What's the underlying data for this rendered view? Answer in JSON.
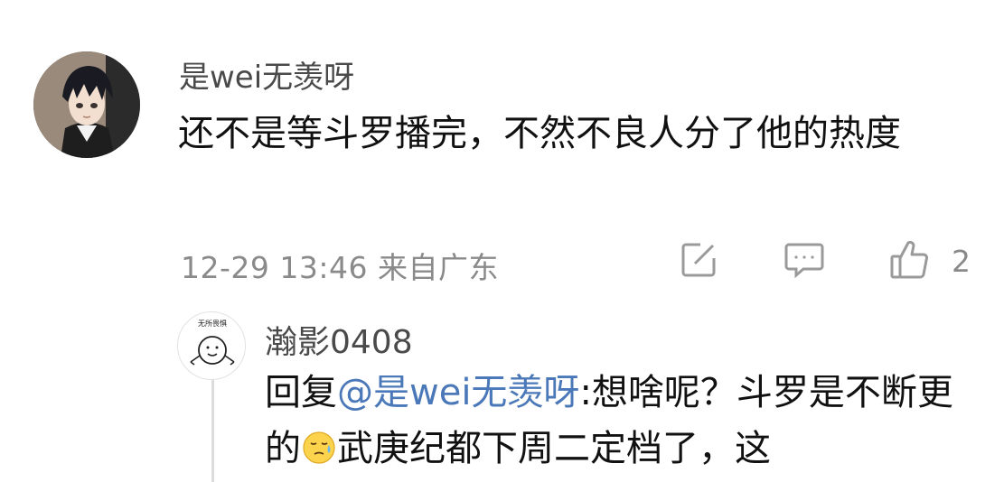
{
  "comment": {
    "username": "是wei无羡呀",
    "text": "还不是等斗罗播完，不然不良人分了他的热度",
    "timestamp": "12-29 13:46",
    "location": "来自广东",
    "like_count": "2",
    "actions": [
      "edit-icon",
      "comment-icon",
      "thumbs-up-icon"
    ]
  },
  "reply": {
    "username": "瀚影0408",
    "avatar_caption": "无所畏惧",
    "prefix": "回复",
    "mention": "@是wei无羡呀",
    "text_before_emoji": ":想啥呢？斗罗是不断更的",
    "emoji": "sweat-emoji",
    "text_after_emoji": "武庚纪都下周二定档了，这"
  },
  "colors": {
    "mention": "#4a78b8",
    "meta": "#8a8a8a",
    "username": "#4a4a4a"
  }
}
